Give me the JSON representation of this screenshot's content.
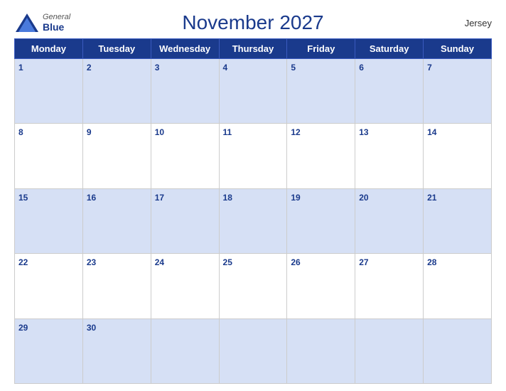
{
  "header": {
    "logo_general": "General",
    "logo_blue": "Blue",
    "title": "November 2027",
    "region": "Jersey"
  },
  "calendar": {
    "days_of_week": [
      "Monday",
      "Tuesday",
      "Wednesday",
      "Thursday",
      "Friday",
      "Saturday",
      "Sunday"
    ],
    "weeks": [
      [
        {
          "day": 1,
          "empty": false
        },
        {
          "day": 2,
          "empty": false
        },
        {
          "day": 3,
          "empty": false
        },
        {
          "day": 4,
          "empty": false
        },
        {
          "day": 5,
          "empty": false
        },
        {
          "day": 6,
          "empty": false
        },
        {
          "day": 7,
          "empty": false
        }
      ],
      [
        {
          "day": 8,
          "empty": false
        },
        {
          "day": 9,
          "empty": false
        },
        {
          "day": 10,
          "empty": false
        },
        {
          "day": 11,
          "empty": false
        },
        {
          "day": 12,
          "empty": false
        },
        {
          "day": 13,
          "empty": false
        },
        {
          "day": 14,
          "empty": false
        }
      ],
      [
        {
          "day": 15,
          "empty": false
        },
        {
          "day": 16,
          "empty": false
        },
        {
          "day": 17,
          "empty": false
        },
        {
          "day": 18,
          "empty": false
        },
        {
          "day": 19,
          "empty": false
        },
        {
          "day": 20,
          "empty": false
        },
        {
          "day": 21,
          "empty": false
        }
      ],
      [
        {
          "day": 22,
          "empty": false
        },
        {
          "day": 23,
          "empty": false
        },
        {
          "day": 24,
          "empty": false
        },
        {
          "day": 25,
          "empty": false
        },
        {
          "day": 26,
          "empty": false
        },
        {
          "day": 27,
          "empty": false
        },
        {
          "day": 28,
          "empty": false
        }
      ],
      [
        {
          "day": 29,
          "empty": false
        },
        {
          "day": 30,
          "empty": false
        },
        {
          "day": null,
          "empty": true
        },
        {
          "day": null,
          "empty": true
        },
        {
          "day": null,
          "empty": true
        },
        {
          "day": null,
          "empty": true
        },
        {
          "day": null,
          "empty": true
        }
      ]
    ]
  }
}
